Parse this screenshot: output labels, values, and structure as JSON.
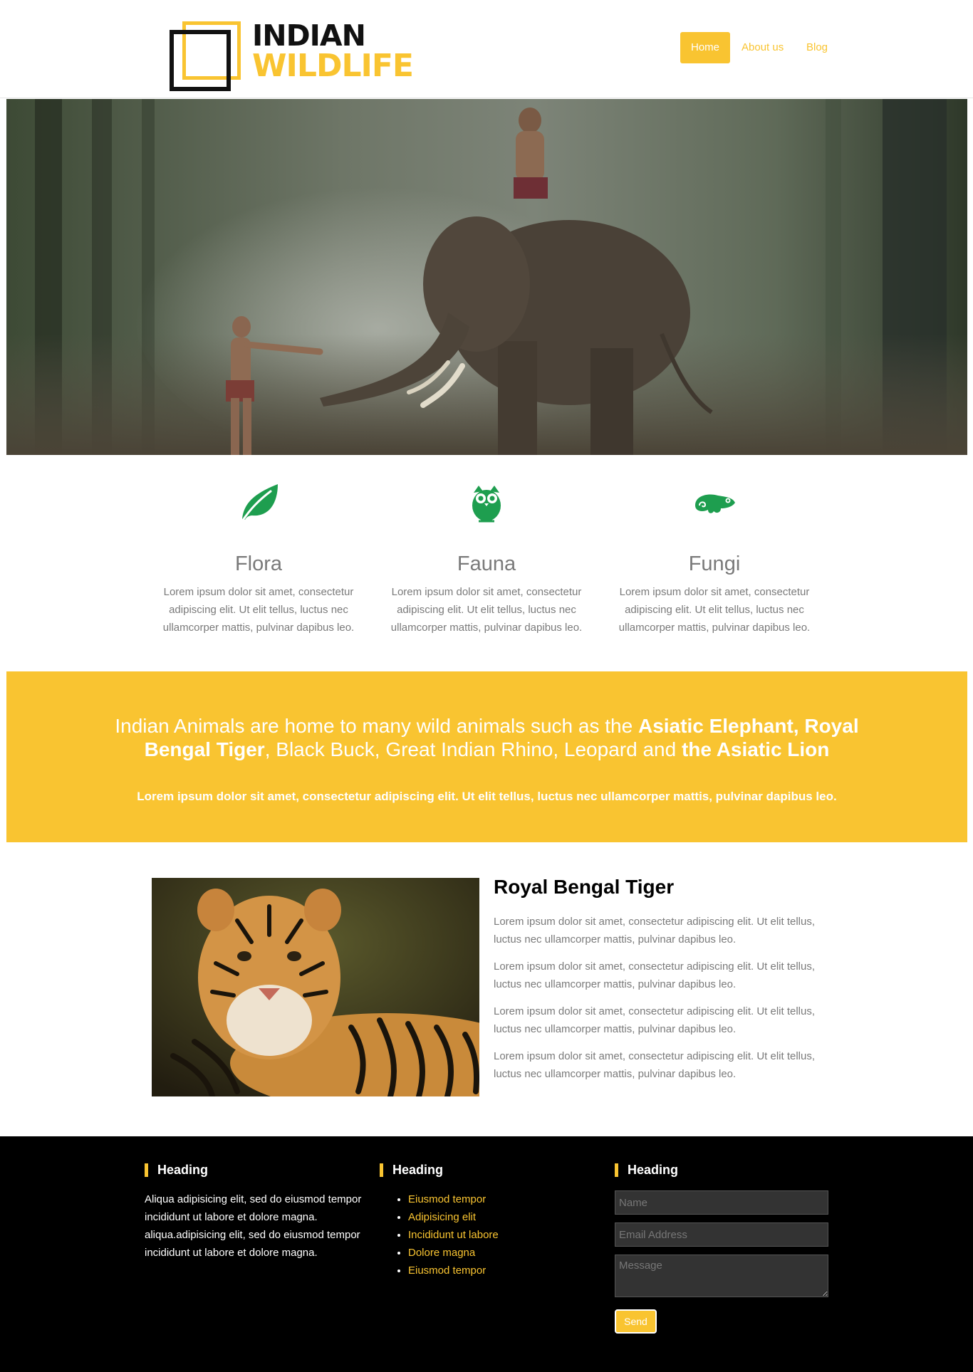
{
  "logo": {
    "line1": "INDIAN",
    "line2": "WILDLIFE"
  },
  "nav": {
    "items": [
      "Home",
      "About us",
      "Blog"
    ],
    "active": "Home"
  },
  "features": [
    {
      "icon": "leaf-icon",
      "title": "Flora",
      "text": "Lorem ipsum dolor sit amet, consectetur adipiscing elit. Ut elit tellus, luctus nec ullamcorper mattis, pulvinar dapibus leo."
    },
    {
      "icon": "owl-icon",
      "title": "Fauna",
      "text": "Lorem ipsum dolor sit amet, consectetur adipiscing elit. Ut elit tellus, luctus nec ullamcorper mattis, pulvinar dapibus leo."
    },
    {
      "icon": "chameleon-icon",
      "title": "Fungi",
      "text": "Lorem ipsum dolor sit amet, consectetur adipiscing elit. Ut elit tellus, luctus nec ullamcorper mattis, pulvinar dapibus leo."
    }
  ],
  "banner": {
    "title_parts": [
      {
        "text": "Indian Animals are home to many wild animals such as the ",
        "bold": false
      },
      {
        "text": "Asiatic Elephant, Royal Bengal Tiger",
        "bold": true
      },
      {
        "text": ", Black Buck, Great Indian Rhino, Leopard and ",
        "bold": false
      },
      {
        "text": "the Asiatic Lion",
        "bold": true
      }
    ],
    "subtitle": "Lorem ipsum dolor sit amet, consectetur adipiscing elit. Ut elit tellus, luctus nec ullamcorper mattis, pulvinar dapibus leo."
  },
  "tiger": {
    "title": "Royal Bengal Tiger",
    "paragraphs": [
      "Lorem ipsum dolor sit amet, consectetur adipiscing elit. Ut elit tellus, luctus nec ullamcorper mattis, pulvinar dapibus leo.",
      "Lorem ipsum dolor sit amet, consectetur adipiscing elit. Ut elit tellus, luctus nec ullamcorper mattis, pulvinar dapibus leo.",
      "Lorem ipsum dolor sit amet, consectetur adipiscing elit. Ut elit tellus, luctus nec ullamcorper mattis, pulvinar dapibus leo.",
      "Lorem ipsum dolor sit amet, consectetur adipiscing elit. Ut elit tellus, luctus nec ullamcorper mattis, pulvinar dapibus leo."
    ]
  },
  "footer": {
    "col1": {
      "heading": "Heading",
      "text": "Aliqua adipisicing elit, sed do eiusmod tempor incididunt ut labore et dolore magna. aliqua.adipisicing elit, sed do eiusmod tempor incididunt ut labore et dolore magna."
    },
    "col2": {
      "heading": "Heading",
      "links": [
        "Eiusmod tempor",
        "Adipisicing elit",
        "Incididunt ut labore",
        "Dolore magna",
        "Eiusmod tempor"
      ]
    },
    "col3": {
      "heading": "Heading",
      "name_placeholder": "Name",
      "email_placeholder": "Email Address",
      "message_placeholder": "Message",
      "send_label": "Send"
    }
  },
  "colors": {
    "accent": "#f9c431",
    "icon_green": "#1e9e4f",
    "footer_bg": "#000000",
    "input_bg": "#333333"
  }
}
